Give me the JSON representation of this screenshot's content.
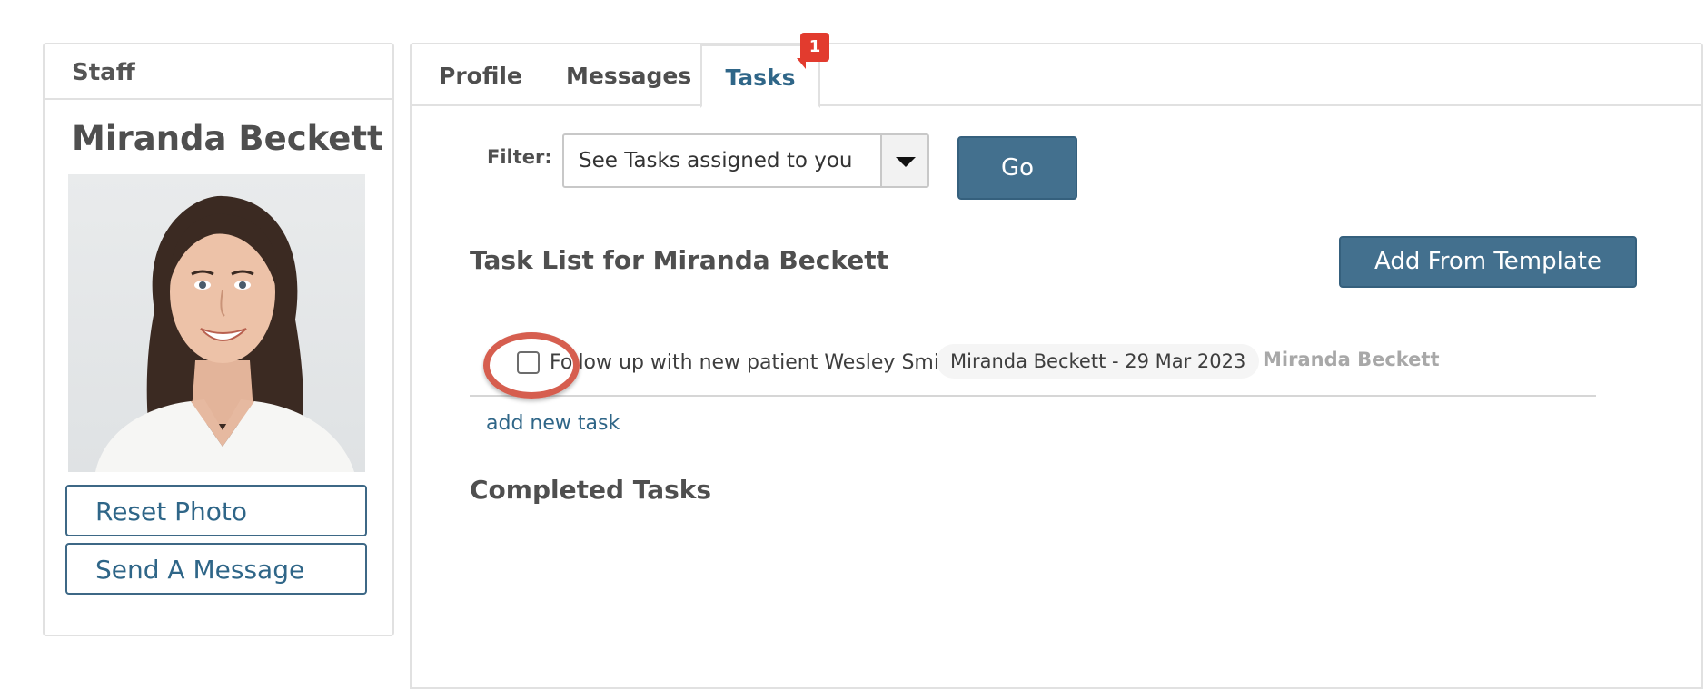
{
  "staff": {
    "header": "Staff",
    "name": "Miranda Beckett",
    "reset_photo_label": "Reset Photo",
    "send_message_label": "Send A Message"
  },
  "tabs": {
    "profile": "Profile",
    "messages": "Messages",
    "tasks": "Tasks",
    "tasks_badge": "1"
  },
  "filter": {
    "label": "Filter:",
    "selected": "See Tasks assigned to you",
    "go_label": "Go"
  },
  "task_list": {
    "title": "Task List for Miranda Beckett",
    "add_template_label": "Add From Template",
    "tasks": [
      {
        "text": "Follow up with new patient Wesley Smith",
        "meta": "Miranda Beckett - 29 Mar 2023",
        "assignee": "Miranda Beckett",
        "checked": false
      }
    ],
    "add_new_task_label": "add new task",
    "completed_title": "Completed Tasks"
  },
  "colors": {
    "accent": "#43708e",
    "badge": "#e23b2e",
    "highlight_ring": "#d65e4f"
  }
}
